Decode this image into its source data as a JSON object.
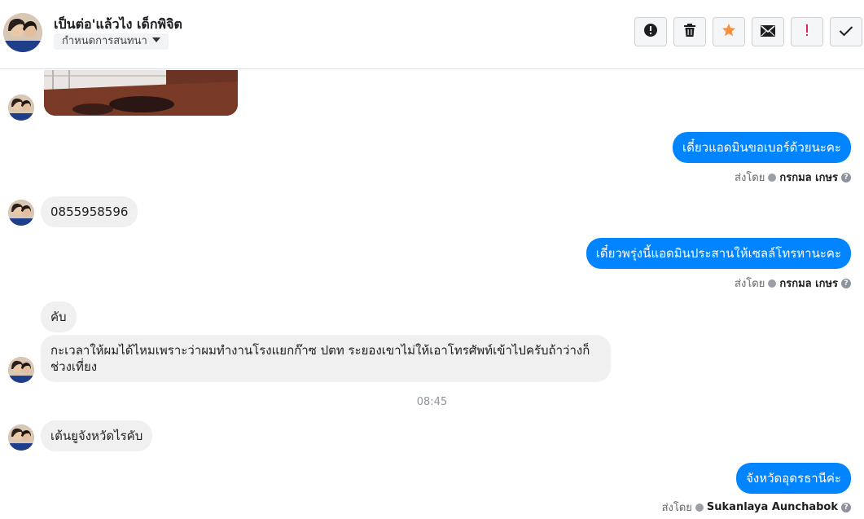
{
  "header": {
    "contact_name": "เป็นต่อ'แล้วไง เด็กพิจิต",
    "assign_label": "กำหนดการสนทนา",
    "actions": [
      {
        "id": "spam",
        "icon": "alert-circle-icon"
      },
      {
        "id": "delete",
        "icon": "trash-icon"
      },
      {
        "id": "star",
        "icon": "star-icon",
        "color": "#f7923b"
      },
      {
        "id": "unread",
        "icon": "envelope-icon"
      },
      {
        "id": "important",
        "icon": "exclamation-icon",
        "color": "#e0245e"
      },
      {
        "id": "done",
        "icon": "check-icon"
      }
    ]
  },
  "colors": {
    "outgoing_bubble": "#0084ff",
    "incoming_bubble": "#f1f0f0"
  },
  "messages": {
    "out1": {
      "text": "เดี๋ยวแอดมินขอเบอร์ด้วยนะคะ",
      "sent_by_label": "ส่งโดย",
      "sender": "กรกมล เกษร"
    },
    "in_phone": {
      "text": "0855958596"
    },
    "out2": {
      "text": "เดี๋ยวพรุ่งนี้แอดมินประสานให้เซลล์โทรหานะคะ",
      "sent_by_label": "ส่งโดย",
      "sender": "กรกมล เกษร"
    },
    "in_kub": {
      "text": "คับ"
    },
    "in_long": {
      "text": "กะเวลาให้ผมได้ไหมเพราะว่าผมทำงานโรงแยกก๊าซ ปตท ระยองเขาไม่ให้เอาโทรศัพท์เข้าไปครับถ้าว่างก็ช่วงเที่ยง"
    },
    "timestamp": "08:45",
    "in_province": {
      "text": "เต้นยูจังหวัดไรคับ"
    },
    "out3": {
      "text": "จังหวัดอุดรธานีค่ะ",
      "sent_by_label": "ส่งโดย",
      "sender": "Sukanlaya Aunchabok"
    }
  }
}
